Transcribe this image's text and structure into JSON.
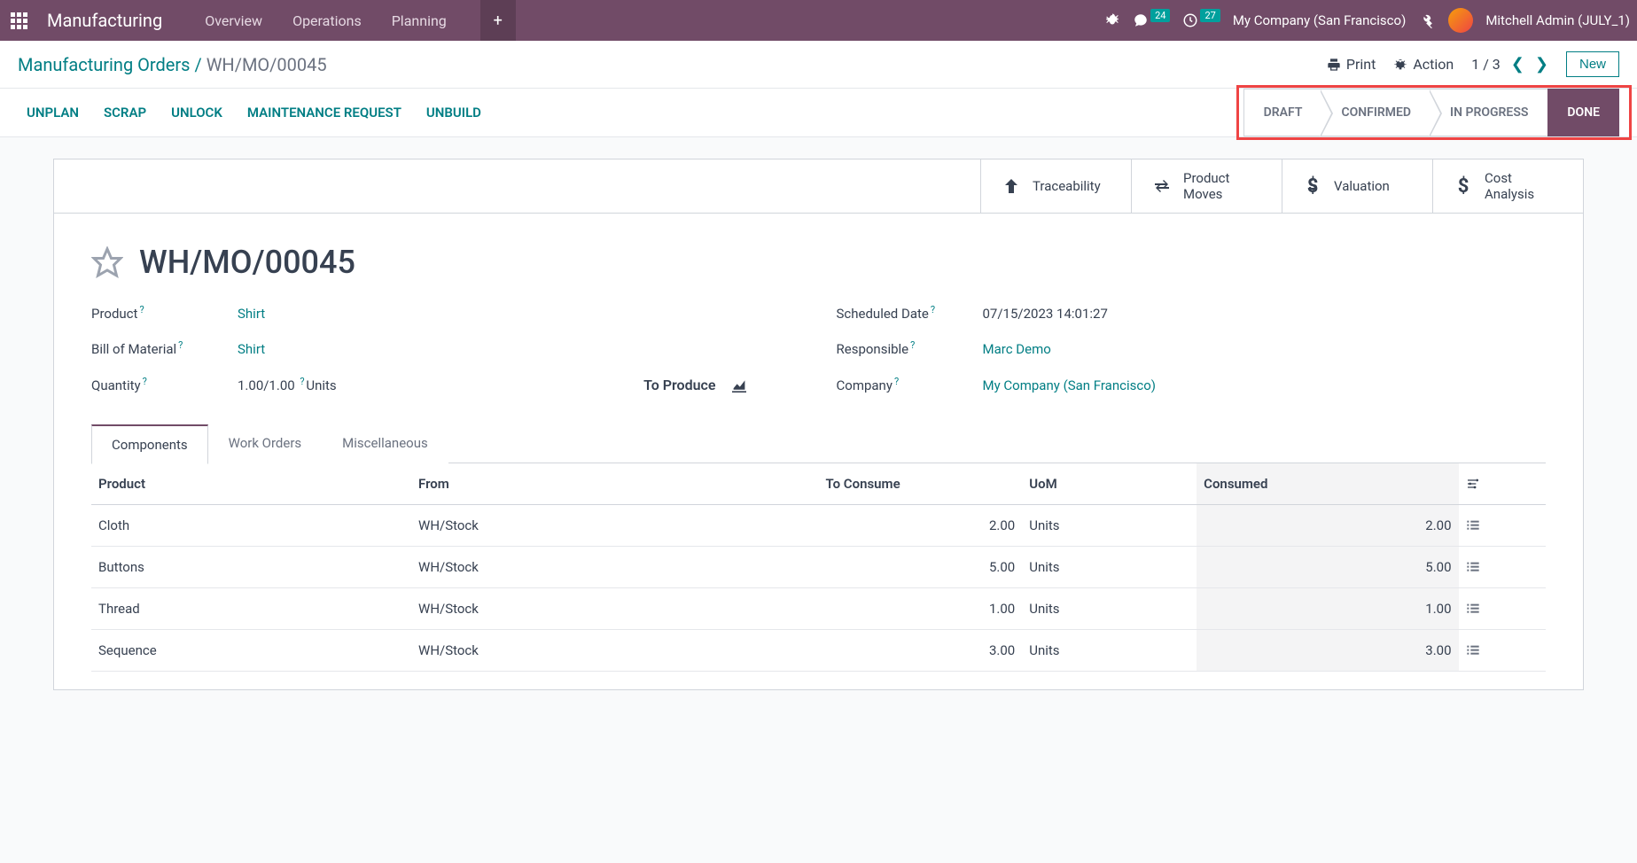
{
  "navbar": {
    "app_name": "Manufacturing",
    "links": [
      "Overview",
      "Operations",
      "Planning"
    ],
    "messages_badge": "24",
    "activities_badge": "27",
    "company": "My Company (San Francisco)",
    "user": "Mitchell Admin (JULY_1)"
  },
  "breadcrumb": {
    "root": "Manufacturing Orders",
    "current": "WH/MO/00045",
    "print": "Print",
    "action": "Action",
    "pager": "1 / 3",
    "new": "New"
  },
  "action_buttons": [
    "UNPLAN",
    "SCRAP",
    "UNLOCK",
    "MAINTENANCE REQUEST",
    "UNBUILD"
  ],
  "status_steps": [
    "DRAFT",
    "CONFIRMED",
    "IN PROGRESS",
    "DONE"
  ],
  "stat_buttons": [
    {
      "icon": "arrow-up",
      "label": "Traceability"
    },
    {
      "icon": "swap",
      "label": "Product\nMoves"
    },
    {
      "icon": "dollar",
      "label": "Valuation"
    },
    {
      "icon": "dollar",
      "label": "Cost\nAnalysis"
    }
  ],
  "record": {
    "title": "WH/MO/00045",
    "product_label": "Product",
    "product": "Shirt",
    "bom_label": "Bill of Material",
    "bom": "Shirt",
    "qty_label": "Quantity",
    "qty": "1.00/1.00",
    "qty_units": "Units",
    "to_produce": "To Produce",
    "scheduled_label": "Scheduled Date",
    "scheduled": "07/15/2023 14:01:27",
    "responsible_label": "Responsible",
    "responsible": "Marc Demo",
    "company_label": "Company",
    "company": "My Company (San Francisco)"
  },
  "tabs": [
    "Components",
    "Work Orders",
    "Miscellaneous"
  ],
  "components_table": {
    "headers": {
      "product": "Product",
      "from": "From",
      "to_consume": "To Consume",
      "uom": "UoM",
      "consumed": "Consumed"
    },
    "rows": [
      {
        "product": "Cloth",
        "from": "WH/Stock",
        "to_consume": "2.00",
        "uom": "Units",
        "consumed": "2.00"
      },
      {
        "product": "Buttons",
        "from": "WH/Stock",
        "to_consume": "5.00",
        "uom": "Units",
        "consumed": "5.00"
      },
      {
        "product": "Thread",
        "from": "WH/Stock",
        "to_consume": "1.00",
        "uom": "Units",
        "consumed": "1.00"
      },
      {
        "product": "Sequence",
        "from": "WH/Stock",
        "to_consume": "3.00",
        "uom": "Units",
        "consumed": "3.00"
      }
    ]
  }
}
